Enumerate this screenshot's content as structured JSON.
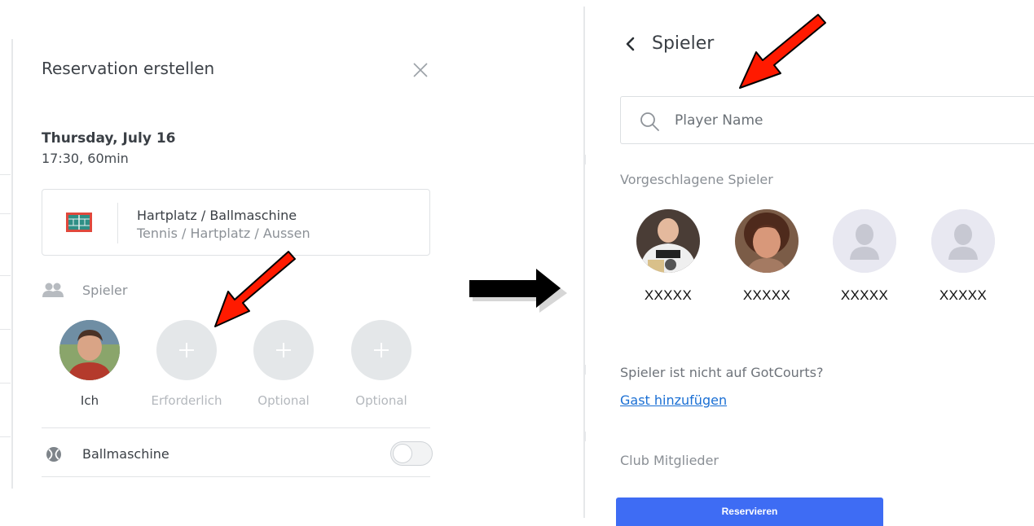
{
  "left_panel": {
    "title": "Reservation erstellen",
    "date": "Thursday, July 16",
    "time": "17:30, 60min",
    "court": {
      "name": "Hartplatz / Ballmaschine",
      "subtitle": "Tennis / Hartplatz / Aussen",
      "icon": "tennis-court-icon"
    },
    "players_label": "Spieler",
    "slots": [
      {
        "label": "Ich",
        "type": "avatar"
      },
      {
        "label": "Erforderlich",
        "type": "add"
      },
      {
        "label": "Optional",
        "type": "add"
      },
      {
        "label": "Optional",
        "type": "add"
      }
    ],
    "ball_machine_label": "Ballmaschine",
    "ball_machine_enabled": false
  },
  "right_panel": {
    "title": "Spieler",
    "search_placeholder": "Player Name",
    "suggested_label": "Vorgeschlagene Spieler",
    "suggested_players": [
      {
        "name": "XXXXX",
        "avatar": "photo"
      },
      {
        "name": "XXXXX",
        "avatar": "photo"
      },
      {
        "name": "XXXXX",
        "avatar": "default-avatar-icon"
      },
      {
        "name": "XXXXX",
        "avatar": "default-avatar-icon"
      }
    ],
    "not_on_label": "Spieler ist nicht auf GotCourts?",
    "guest_link": "Gast hinzufügen",
    "members_label": "Club Mitglieder",
    "reserve_button": "Reservieren"
  },
  "colors": {
    "annotation_arrow": "#ff0000",
    "primary_button": "#3e6cf4",
    "link": "#1a6fd4",
    "court_icon": "#e0483c"
  }
}
